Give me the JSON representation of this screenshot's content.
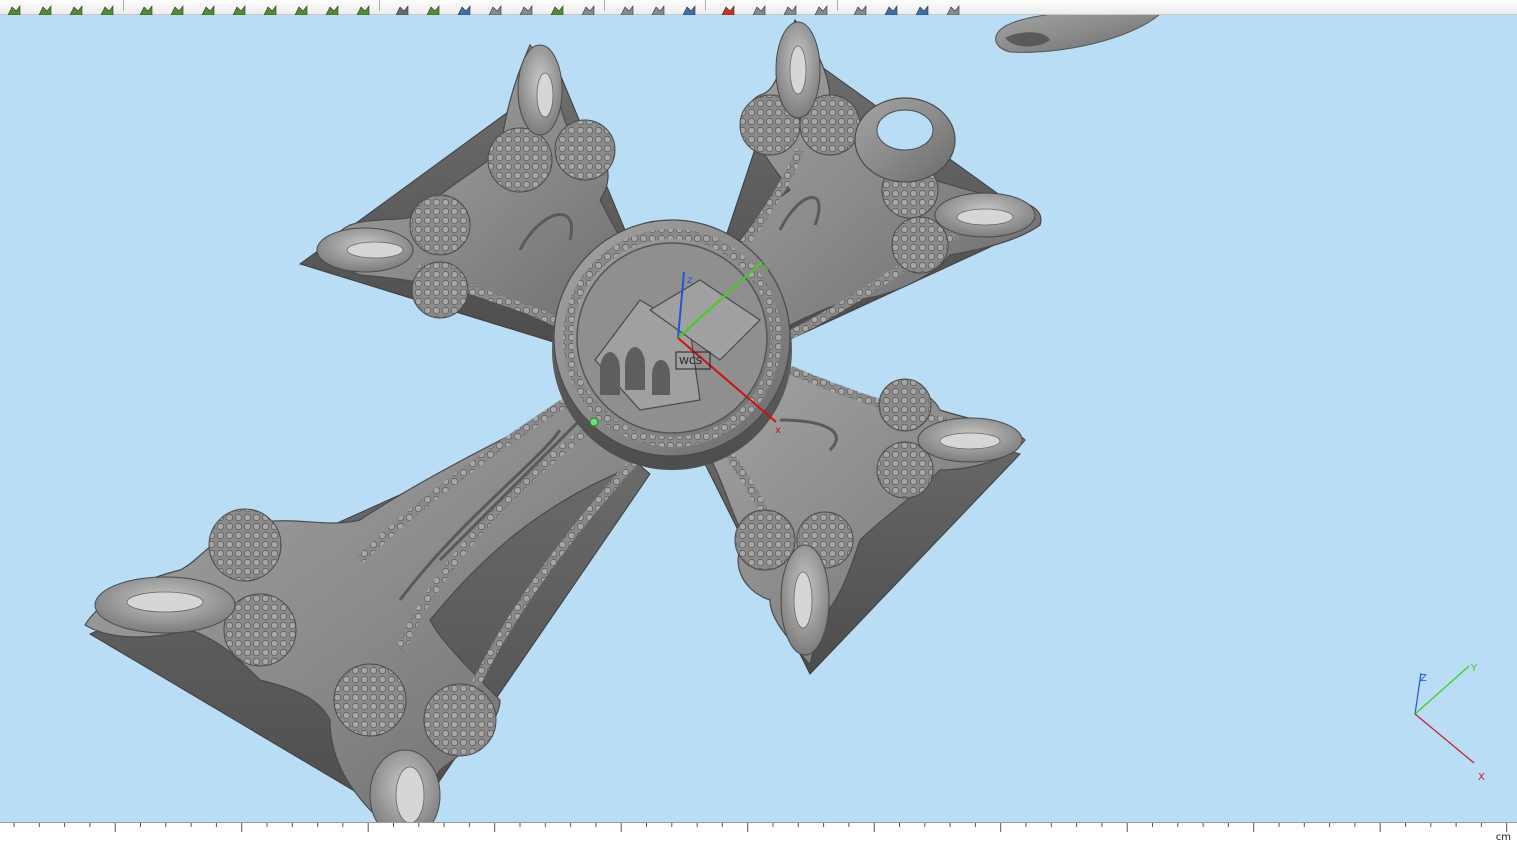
{
  "toolbar": {
    "buttons": [
      {
        "name": "select-arrow-icon",
        "color": "#4f8f2f"
      },
      {
        "name": "select-faces-icon",
        "color": "#4f8f2f"
      },
      {
        "name": "select-edges-icon",
        "color": "#4f8f2f"
      },
      {
        "name": "select-vertices-icon",
        "color": "#4f8f2f"
      },
      {
        "name": "extrude-icon",
        "color": "#4f8f2f"
      },
      {
        "name": "revolve-icon",
        "color": "#4f8f2f"
      },
      {
        "name": "sweep-icon",
        "color": "#4f8f2f"
      },
      {
        "name": "loft-icon",
        "color": "#4f8f2f"
      },
      {
        "name": "shell-icon",
        "color": "#4f8f2f"
      },
      {
        "name": "fillet-icon",
        "color": "#4f8f2f"
      },
      {
        "name": "chamfer-icon",
        "color": "#4f8f2f"
      },
      {
        "name": "boolean-icon",
        "color": "#4f8f2f"
      },
      {
        "name": "view-front-icon",
        "color": "#6a6a6a"
      },
      {
        "name": "view-top-icon",
        "color": "#4f8f2f"
      },
      {
        "name": "view-right-icon",
        "color": "#3b6fb0"
      },
      {
        "name": "view-iso-icon",
        "color": "#8a8a8a"
      },
      {
        "name": "view-back-icon",
        "color": "#8a8a8a"
      },
      {
        "name": "view-bottom-icon",
        "color": "#4f8f2f"
      },
      {
        "name": "wrench-icon",
        "color": "#8a8a8a"
      },
      {
        "name": "measure-icon",
        "color": "#8a8a8a"
      },
      {
        "name": "ruler-icon",
        "color": "#8a8a8a"
      },
      {
        "name": "render-icon",
        "color": "#3b6fb0"
      },
      {
        "name": "delete-icon",
        "color": "#d03020"
      },
      {
        "name": "hide-icon",
        "color": "#8a8a8a"
      },
      {
        "name": "layer-icon",
        "color": "#8a8a8a"
      },
      {
        "name": "properties-icon",
        "color": "#8a8a8a"
      },
      {
        "name": "camera-icon",
        "color": "#8a8a8a"
      },
      {
        "name": "light-icon",
        "color": "#3b6fb0"
      },
      {
        "name": "material-icon",
        "color": "#3b6fb0"
      },
      {
        "name": "settings-icon",
        "color": "#8a8a8a"
      }
    ]
  },
  "viewport": {
    "background": "#b9ddf5",
    "model_color": "#8a8a8a",
    "model_name": "cross-pendant-model",
    "wcs": {
      "label": "WCS",
      "axes": {
        "x": "x",
        "y": "y",
        "z": "z"
      },
      "colors": {
        "x": "#d01010",
        "y": "#44cc22",
        "z": "#2255dd"
      }
    },
    "triad": {
      "axes": {
        "x": "X",
        "y": "Y",
        "z": "Z"
      },
      "colors": {
        "x": "#c02020",
        "y": "#44cc22",
        "z": "#2255dd"
      }
    }
  },
  "ruler": {
    "unit": "cm"
  }
}
